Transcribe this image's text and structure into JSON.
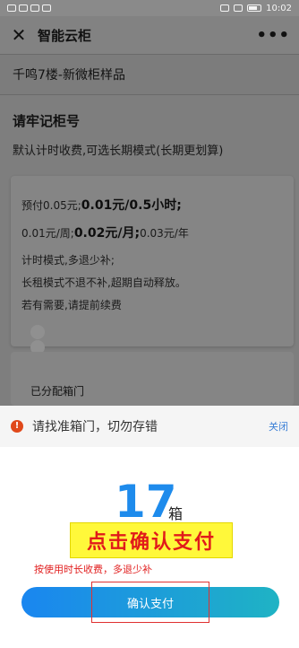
{
  "status_bar": {
    "time": "10:02"
  },
  "nav": {
    "title": "智能云柜",
    "close_glyph": "✕",
    "more_glyph": "•••"
  },
  "location": {
    "text": "千鸣7楼-新微柜样品"
  },
  "section": {
    "title": "请牢记柜号",
    "desc": "默认计时收费,可选长期模式(长期更划算)"
  },
  "pricing": {
    "prepay": "预付0.05元;",
    "rate_hour": "0.01元/0.5小时;",
    "week": "0.01元/周;",
    "month": "0.02元/月;",
    "year": "0.03元/年",
    "line3": "计时模式,多退少补;",
    "line4": "长租模式不退不补,超期自动释放。",
    "line5": "若有需要,请提前续费"
  },
  "assigned": {
    "label": "已分配箱门"
  },
  "notice": {
    "text": "请找准箱门，切勿存错",
    "close": "关闭",
    "icon_glyph": "!"
  },
  "sheet": {
    "box_number": "17",
    "box_unit": "箱",
    "callout": "点击确认支付",
    "hint": "按使用时长收费，多退少补",
    "pay_button": "确认支付"
  },
  "colors": {
    "accent_blue": "#1e8bec",
    "warning": "#e0491b",
    "hint_red": "#e11f1f",
    "callout_bg": "#fff83a"
  }
}
